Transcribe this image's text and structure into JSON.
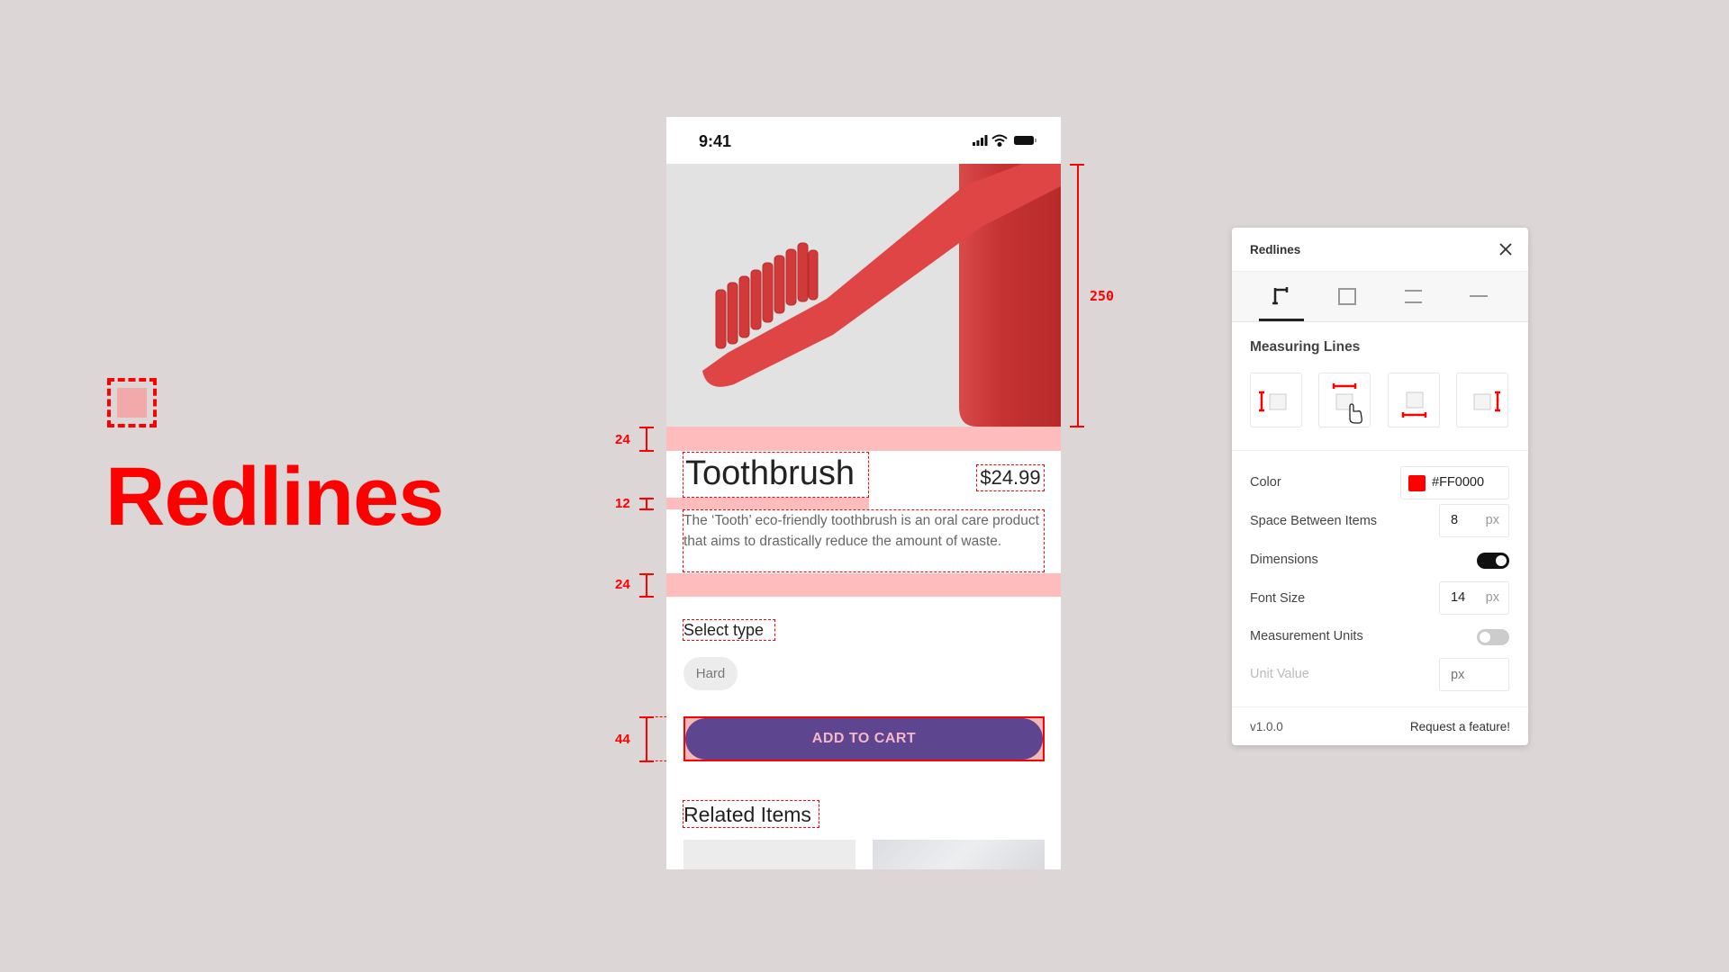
{
  "brand": {
    "title": "Redlines"
  },
  "phone": {
    "status_time": "9:41",
    "product_title": "Toothbrush",
    "price": "$24.99",
    "description": "The ‘Tooth’ eco-friendly toothbrush is an oral care product that aims to drastically reduce the amount of waste.",
    "select_type_label": "Select type",
    "type_option": "Hard",
    "add_to_cart": "ADD TO CART",
    "related_items": "Related Items",
    "button_color": "#5e4590"
  },
  "measurements": {
    "image_height": "250",
    "top_gap": "24",
    "title_gap": "12",
    "bottom_gap": "24",
    "button_height": "44"
  },
  "panel": {
    "title": "Redlines",
    "tabs": [
      "measure-icon",
      "box-icon",
      "double-line-icon",
      "line-icon"
    ],
    "active_tab": 0,
    "section_title": "Measuring Lines",
    "measure_buttons": [
      "left",
      "top",
      "bottom",
      "right"
    ],
    "color_label": "Color",
    "color_value": "#FF0000",
    "space_label": "Space Between Items",
    "space_value": "8",
    "unit_px": "px",
    "dimensions_label": "Dimensions",
    "dimensions_on": true,
    "font_size_label": "Font Size",
    "font_size_value": "14",
    "measurement_units_label": "Measurement Units",
    "measurement_units_on": false,
    "unit_value_label": "Unit Value",
    "unit_value_placeholder": "px",
    "version": "v1.0.0",
    "request_feature": "Request a feature!"
  },
  "colors": {
    "background": "#dcd6d6",
    "accent": "#ff0000",
    "highlight": "#ffbcbc"
  }
}
